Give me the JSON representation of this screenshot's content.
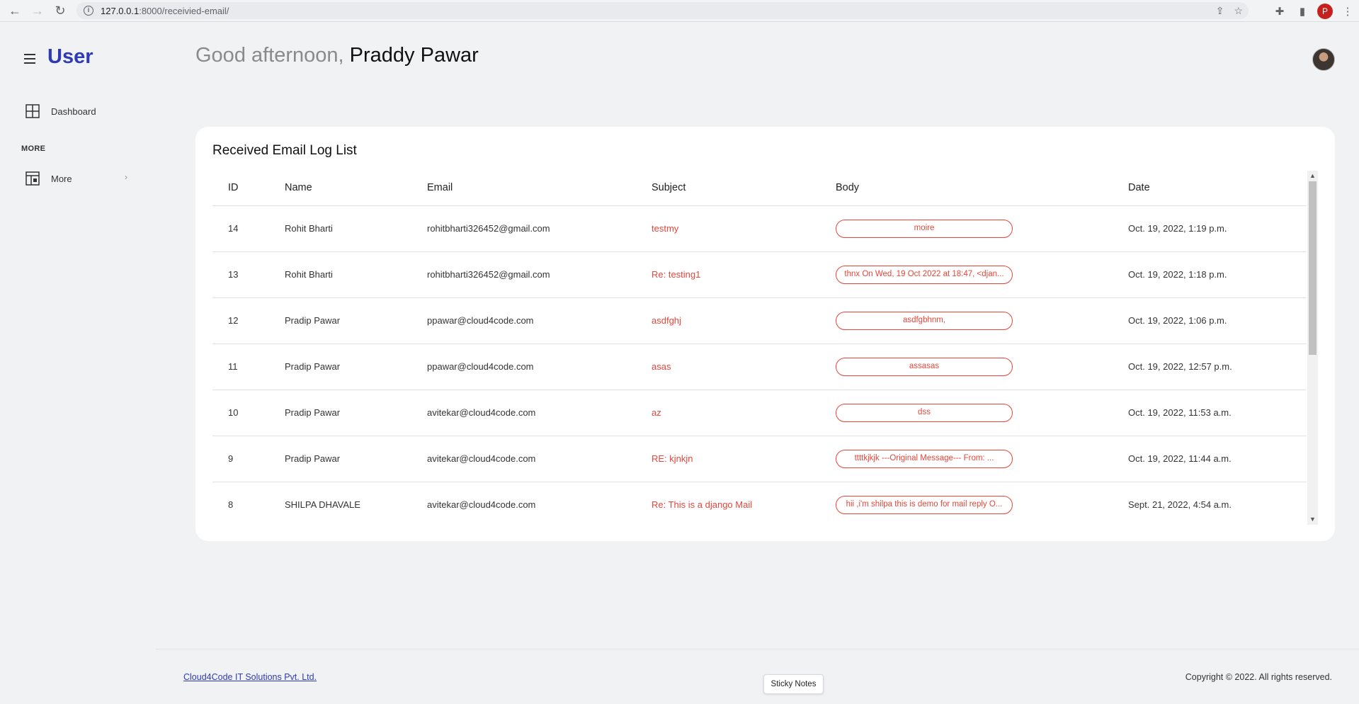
{
  "browser": {
    "url_host": "127.0.0.1",
    "url_path": ":8000/receivied-email/",
    "profile_initial": "P"
  },
  "sidebar": {
    "brand": "User",
    "items": [
      {
        "label": "Dashboard",
        "icon": "grid-icon"
      },
      {
        "label": "More",
        "icon": "layout-icon",
        "chevron": "›"
      }
    ],
    "section_heading": "MORE"
  },
  "header": {
    "greeting": "Good afternoon,",
    "user_name": "Praddy Pawar"
  },
  "card": {
    "title": "Received Email Log List",
    "columns": [
      "ID",
      "Name",
      "Email",
      "Subject",
      "Body",
      "Date"
    ],
    "rows": [
      {
        "id": "14",
        "name": "Rohit Bharti",
        "email": "rohitbharti326452@gmail.com",
        "subject": "testmy",
        "body": "moire",
        "date": "Oct. 19, 2022, 1:19 p.m."
      },
      {
        "id": "13",
        "name": "Rohit Bharti",
        "email": "rohitbharti326452@gmail.com",
        "subject": "Re: testing1",
        "body": "thnx On Wed, 19 Oct 2022 at 18:47, <djan...",
        "date": "Oct. 19, 2022, 1:18 p.m."
      },
      {
        "id": "12",
        "name": "Pradip Pawar",
        "email": "ppawar@cloud4code.com",
        "subject": "asdfghj",
        "body": "asdfgbhnm,",
        "date": "Oct. 19, 2022, 1:06 p.m."
      },
      {
        "id": "11",
        "name": "Pradip Pawar",
        "email": "ppawar@cloud4code.com",
        "subject": "asas",
        "body": "assasas",
        "date": "Oct. 19, 2022, 12:57 p.m."
      },
      {
        "id": "10",
        "name": "Pradip Pawar",
        "email": "avitekar@cloud4code.com",
        "subject": "az",
        "body": "dss",
        "date": "Oct. 19, 2022, 11:53 a.m."
      },
      {
        "id": "9",
        "name": "Pradip Pawar",
        "email": "avitekar@cloud4code.com",
        "subject": "RE: kjnkjn",
        "body": "ttttkjkjk ---Original Message--- From: ...",
        "date": "Oct. 19, 2022, 11:44 a.m."
      },
      {
        "id": "8",
        "name": "SHILPA DHAVALE",
        "email": "avitekar@cloud4code.com",
        "subject": "Re: This is a django Mail",
        "body": "hii ,i'm shilpa this is demo for mail reply O...",
        "date": "Sept. 21, 2022, 4:54 a.m."
      }
    ]
  },
  "footer": {
    "company_link": "Cloud4Code IT Solutions Pvt. Ltd.",
    "copyright": "Copyright © 2022. All rights reserved.",
    "sticky_notes": "Sticky Notes"
  },
  "colors": {
    "brand": "#2e3bb5",
    "accent_red": "#e5463b",
    "page_bg": "#f1f2f4"
  }
}
